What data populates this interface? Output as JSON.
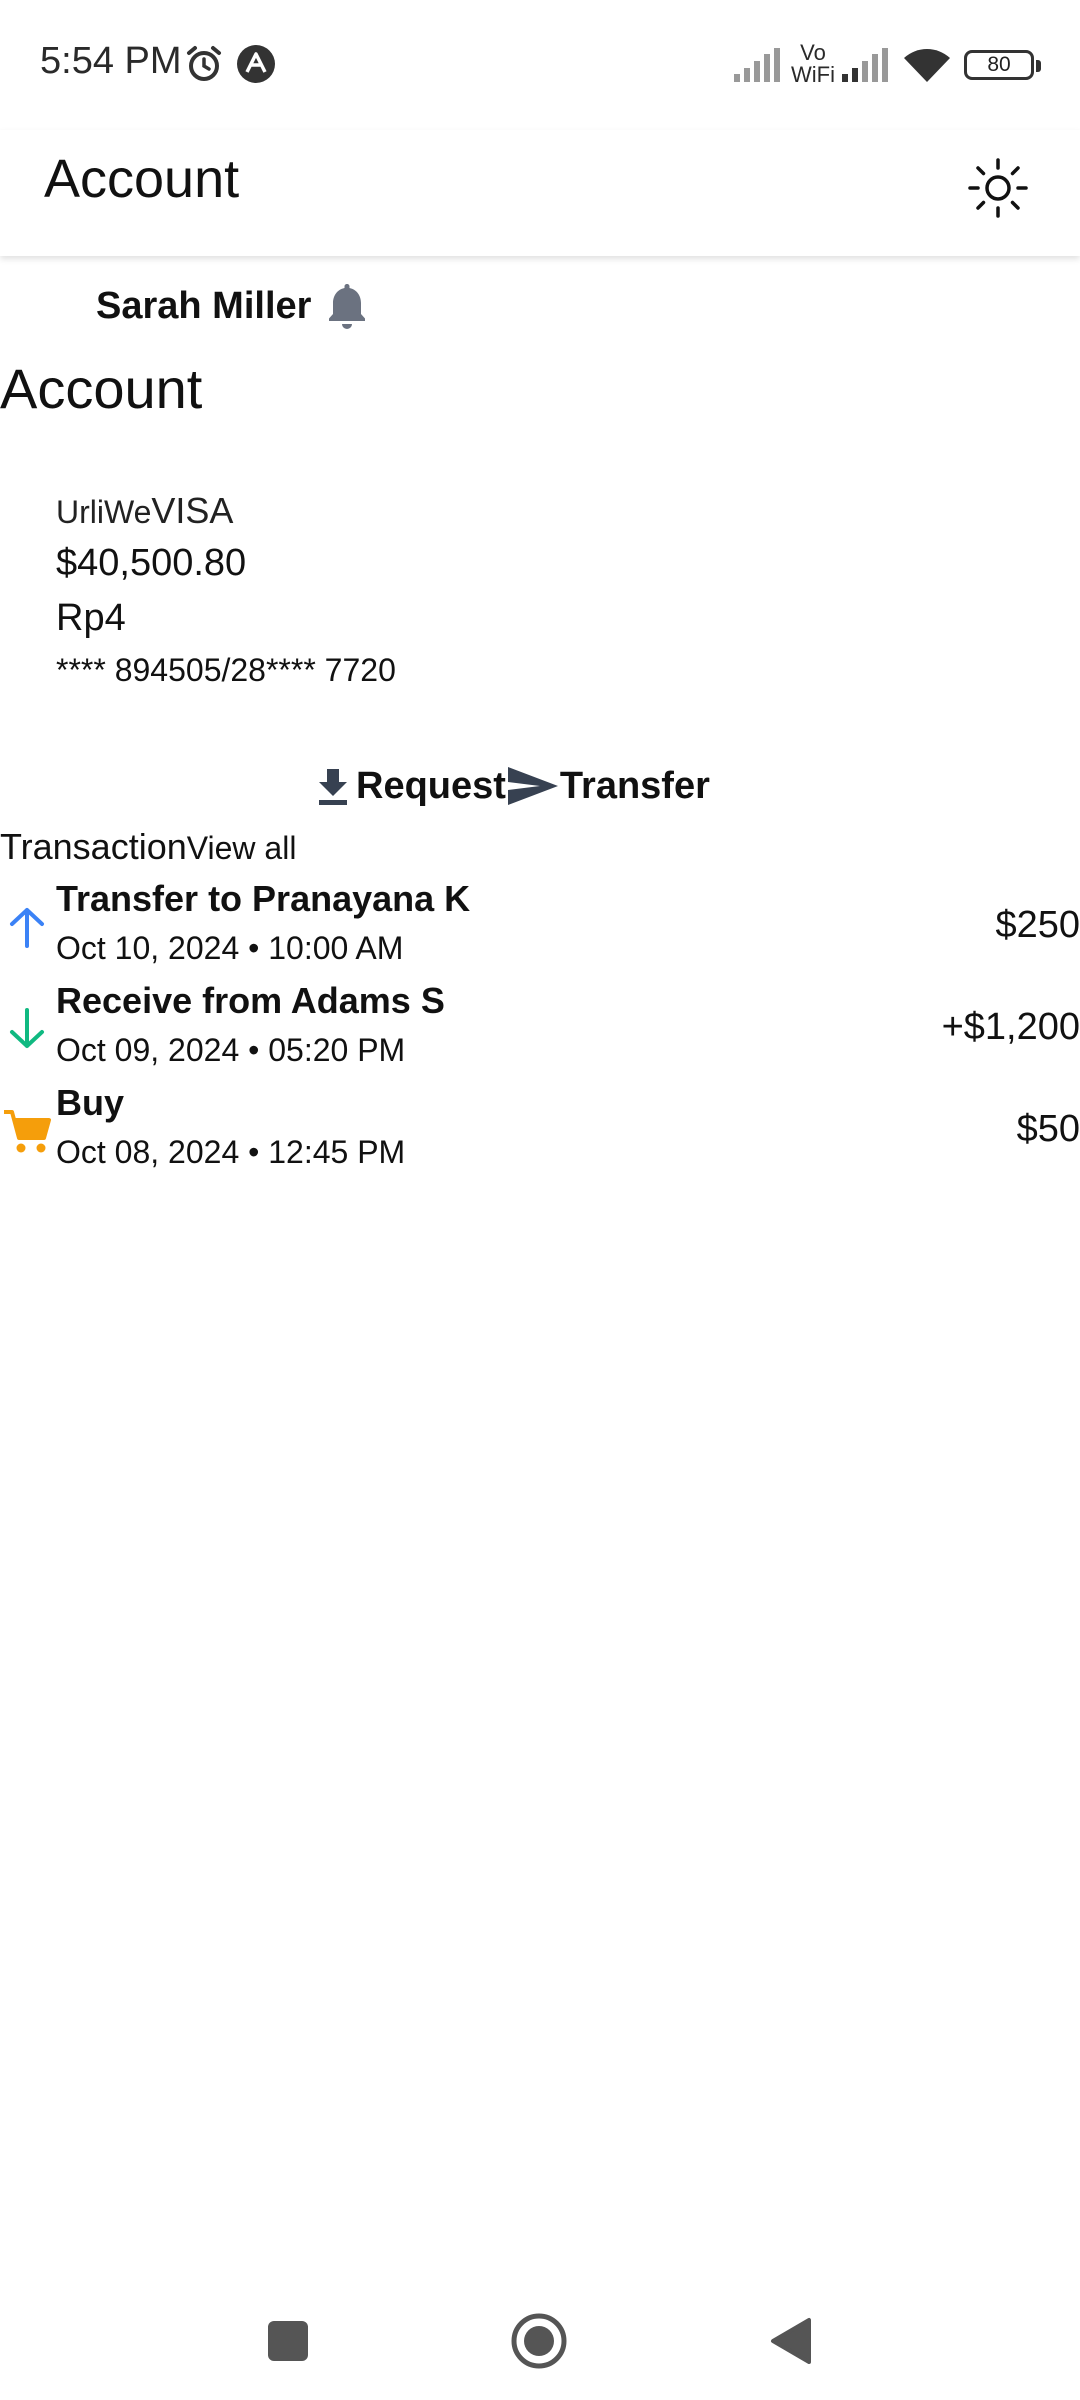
{
  "status_bar": {
    "time": "5:54 PM",
    "vowifi_top": "Vo",
    "vowifi_bottom": "WiFi",
    "battery": "80",
    "icons": [
      "alarm-icon",
      "app-a-icon",
      "signal-icon",
      "vowifi-icon",
      "signal-icon",
      "wifi-icon",
      "battery-icon"
    ]
  },
  "app_bar": {
    "title": "Account",
    "theme_icon": "sun-icon"
  },
  "user": {
    "name": "Sarah Miller",
    "notification_icon": "bell-icon"
  },
  "section_title": "Account",
  "card": {
    "issuer": "UrliWe",
    "network": "VISA",
    "balance": "$40,500.80",
    "secondary_balance": "Rp4",
    "number": "**** 894505/28**** 7720"
  },
  "actions": {
    "request_label": "Request",
    "transfer_label": "Transfer",
    "request_icon": "download-icon",
    "transfer_icon": "send-icon"
  },
  "transactions": {
    "title": "Transaction",
    "view_all": "View all",
    "items": [
      {
        "name": "Transfer to Pranayana K",
        "date": "Oct 10, 2024 • 10:00 AM",
        "amount": "$250",
        "icon": "arrow-up-icon",
        "color": "#3b82f6"
      },
      {
        "name": "Receive from Adams S",
        "date": "Oct 09, 2024 • 05:20 PM",
        "amount": "+$1,200",
        "icon": "arrow-down-icon",
        "color": "#10b981"
      },
      {
        "name": "Buy",
        "date": "Oct 08, 2024 • 12:45 PM",
        "amount": "$50",
        "icon": "cart-icon",
        "color": "#f59e0b"
      }
    ]
  },
  "nav_bar": {
    "buttons": [
      "recents-icon",
      "home-icon",
      "back-icon"
    ]
  },
  "colors": {
    "bell": "#6b7280",
    "action_icon": "#374151",
    "nav_icon": "#555555"
  }
}
